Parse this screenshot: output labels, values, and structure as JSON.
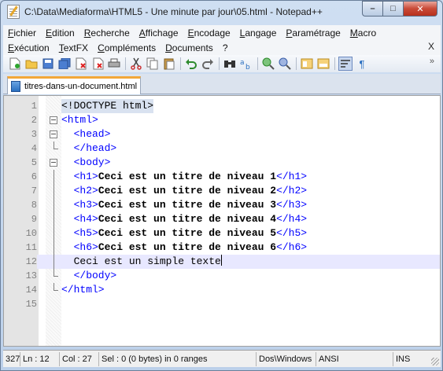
{
  "window": {
    "title": "C:\\Data\\Mediaforma\\HTML5 - Une minute par jour\\05.html - Notepad++",
    "controls": {
      "minimize": "–",
      "maximize": "□",
      "close": "✕"
    }
  },
  "menu": {
    "row1": [
      "Fichier",
      "Edition",
      "Recherche",
      "Affichage",
      "Encodage",
      "Langage",
      "Paramétrage",
      "Macro"
    ],
    "row2": [
      "Exécution",
      "TextFX",
      "Compléments",
      "Documents",
      "?"
    ],
    "close_label": "X"
  },
  "toolbar": {
    "icons": [
      "new-file-icon",
      "open-file-icon",
      "save-icon",
      "save-all-icon",
      "close-icon",
      "close-all-icon",
      "print-icon",
      "cut-icon",
      "copy-icon",
      "paste-icon",
      "undo-icon",
      "redo-icon",
      "find-icon",
      "replace-icon",
      "zoom-in-icon",
      "zoom-out-icon",
      "sync-vertical-icon",
      "sync-horizontal-icon",
      "word-wrap-icon",
      "show-all-chars-icon"
    ],
    "overflow": "»"
  },
  "tabs": [
    {
      "label": "titres-dans-un-document.html"
    }
  ],
  "editor": {
    "current_line": 12,
    "lines": [
      {
        "n": "1",
        "code": "<!DOCTYPE html>"
      },
      {
        "n": "2",
        "code": "<html>"
      },
      {
        "n": "3",
        "code": "  <head>"
      },
      {
        "n": "4",
        "code": "  </head>"
      },
      {
        "n": "5",
        "code": "  <body>"
      },
      {
        "n": "6",
        "tag_open": "  <h1>",
        "text": "Ceci est un titre de niveau 1",
        "tag_close": "</h1>"
      },
      {
        "n": "7",
        "tag_open": "  <h2>",
        "text": "Ceci est un titre de niveau 2",
        "tag_close": "</h2>"
      },
      {
        "n": "8",
        "tag_open": "  <h3>",
        "text": "Ceci est un titre de niveau 3",
        "tag_close": "</h3>"
      },
      {
        "n": "9",
        "tag_open": "  <h4>",
        "text": "Ceci est un titre de niveau 4",
        "tag_close": "</h4>"
      },
      {
        "n": "10",
        "tag_open": "  <h5>",
        "text": "Ceci est un titre de niveau 5",
        "tag_close": "</h5>"
      },
      {
        "n": "11",
        "tag_open": "  <h6>",
        "text": "Ceci est un titre de niveau 6",
        "tag_close": "</h6>"
      },
      {
        "n": "12",
        "code": "  Ceci est un simple texte"
      },
      {
        "n": "13",
        "code": "  </body>"
      },
      {
        "n": "14",
        "code": "</html>"
      },
      {
        "n": "15",
        "code": ""
      }
    ]
  },
  "status": {
    "length": "327",
    "ln": "Ln : 12",
    "col": "Col : 27",
    "sel": "Sel : 0 (0 bytes) in 0 ranges",
    "eol": "Dos\\Windows",
    "encoding": "ANSI",
    "mode": "INS"
  }
}
